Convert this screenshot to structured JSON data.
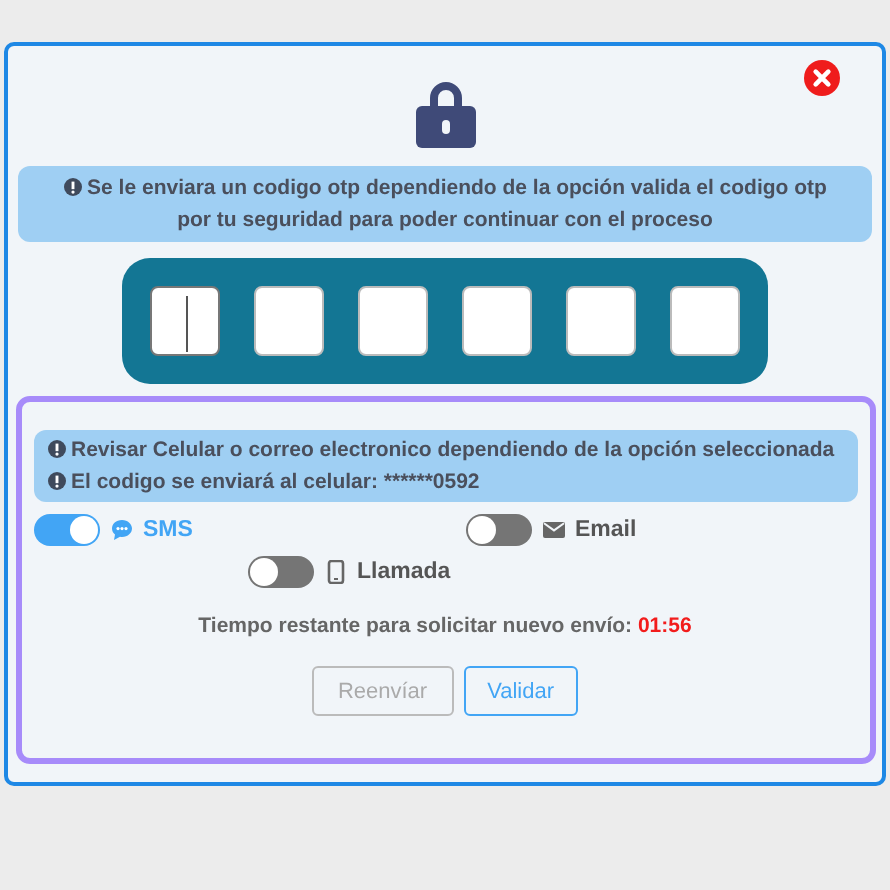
{
  "dialog": {
    "notice": "Se le enviara un codigo otp dependiendo de la opción valida el codigo otp por tu seguridad para poder continuar con el proceso",
    "otp_fields": [
      {
        "focused": true
      },
      {
        "focused": false
      },
      {
        "focused": false
      },
      {
        "focused": false
      },
      {
        "focused": false
      },
      {
        "focused": false
      }
    ],
    "info_lines": [
      "Revisar Celular o correo electronico dependiendo de la opción seleccionada",
      "El codigo se enviará al celular: ******0592"
    ],
    "options": [
      {
        "label": "SMS",
        "on": true
      },
      {
        "label": "Email",
        "on": false
      },
      {
        "label": "Llamada",
        "on": false
      }
    ],
    "timer": {
      "label": "Tiempo restante para solicitar nuevo envío:",
      "value": "01:56"
    },
    "buttons": [
      {
        "label": "Reenvíar",
        "disabled": true
      },
      {
        "label": "Validar",
        "disabled": false
      }
    ]
  }
}
